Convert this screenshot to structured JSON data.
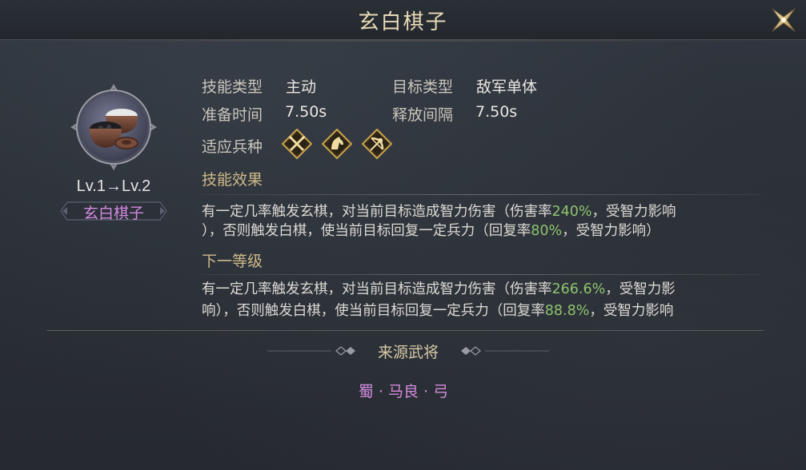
{
  "title": "玄白棋子",
  "skill": {
    "level_text": "Lv.1→Lv.2",
    "name": "玄白棋子"
  },
  "info": {
    "skill_type_label": "技能类型",
    "skill_type_value": "主动",
    "target_type_label": "目标类型",
    "target_type_value": "敌军单体",
    "prep_time_label": "准备时间",
    "prep_time_value": "7.50s",
    "cast_interval_label": "释放间隔",
    "cast_interval_value": "7.50s",
    "troop_types_label": "适应兵种",
    "troop_types": [
      "infantry-icon",
      "cavalry-icon",
      "archer-icon"
    ]
  },
  "effect": {
    "header": "技能效果",
    "line1_a": "有一定几率触发玄棋，对当前目标造成智力伤害（伤害率",
    "line1_hl": "240%",
    "line1_b": "，受智力影响",
    "line2_a": "），否则触发白棋，使当前目标回复一定兵力（回复率",
    "line2_hl": "80%",
    "line2_b": "，受智力影响）"
  },
  "next_level": {
    "header": "下一等级",
    "line1_a": "有一定几率触发玄棋，对当前目标造成智力伤害（伤害率",
    "line1_hl": "266.6%",
    "line1_b": "，受智力影",
    "line2_a": "响），否则触发白棋，使当前目标回复一定兵力（回复率",
    "line2_hl": "88.8%",
    "line2_b": "，受智力影响",
    "line3": "）"
  },
  "source": {
    "header": "来源武将",
    "general": "蜀 · 马良 · 弓"
  },
  "colors": {
    "title": "#e8d9b5",
    "section": "#cdb98a",
    "highlight": "#8ec46f",
    "name": "#d48be0"
  }
}
